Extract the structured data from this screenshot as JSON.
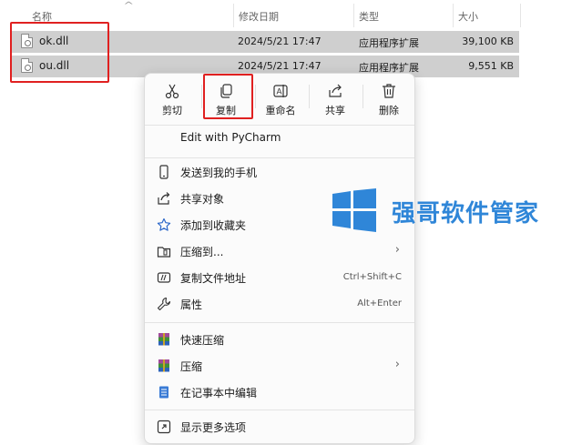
{
  "columns": {
    "name": "名称",
    "modified": "修改日期",
    "type": "类型",
    "size": "大小"
  },
  "files": [
    {
      "name": "ok.dll",
      "modified": "2024/5/21 17:47",
      "type": "应用程序扩展",
      "size": "39,100 KB"
    },
    {
      "name": "ou.dll",
      "modified": "2024/5/21 17:47",
      "type": "应用程序扩展",
      "size": "9,551 KB"
    }
  ],
  "toolbar": {
    "cut": "剪切",
    "copy": "复制",
    "rename": "重命名",
    "share": "共享",
    "delete": "删除"
  },
  "menu": {
    "pycharm": "Edit with PyCharm",
    "send_phone": "发送到我的手机",
    "share_object": "共享对象",
    "add_favorite": "添加到收藏夹",
    "compress_to": "压缩到...",
    "copy_path": "复制文件地址",
    "copy_path_shortcut": "Ctrl+Shift+C",
    "properties": "属性",
    "properties_shortcut": "Alt+Enter",
    "quick_compress": "快速压缩",
    "compress": "压缩",
    "notepad_edit": "在记事本中编辑",
    "more_options": "显示更多选项"
  },
  "watermark": {
    "text": "强哥软件管家"
  },
  "colors": {
    "highlight_red": "#e02020",
    "watermark_blue": "#2f86d8",
    "selection_gray": "#cfcfcf"
  }
}
